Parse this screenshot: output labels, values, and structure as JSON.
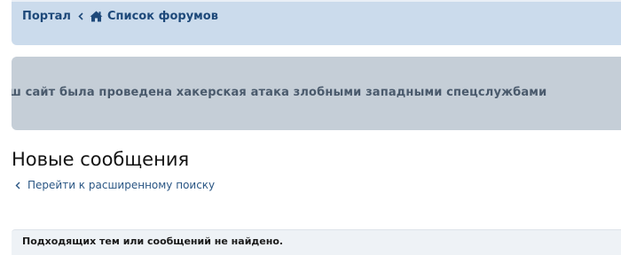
{
  "breadcrumb": {
    "items": [
      {
        "label": "Портал"
      },
      {
        "label": "Список форумов"
      }
    ]
  },
  "notice": {
    "text": "ш сайт была проведена хакерская атака злобными западными спецслужбами"
  },
  "page": {
    "title": "Новые сообщения",
    "advanced_search_link": "Перейти к расширенному поиску"
  },
  "results": {
    "empty_message": "Подходящих тем или сообщений не найдено."
  },
  "colors": {
    "breadcrumb_bg": "#cbdbec",
    "breadcrumb_text": "#1e497a",
    "notice_bg": "#c5ced7",
    "notice_text": "#4a5a6c",
    "link": "#2a5684",
    "result_bg": "#eef2f6"
  },
  "icons": {
    "home": "home-icon",
    "separator": "chevron-left-icon",
    "back": "chevron-left-icon"
  }
}
